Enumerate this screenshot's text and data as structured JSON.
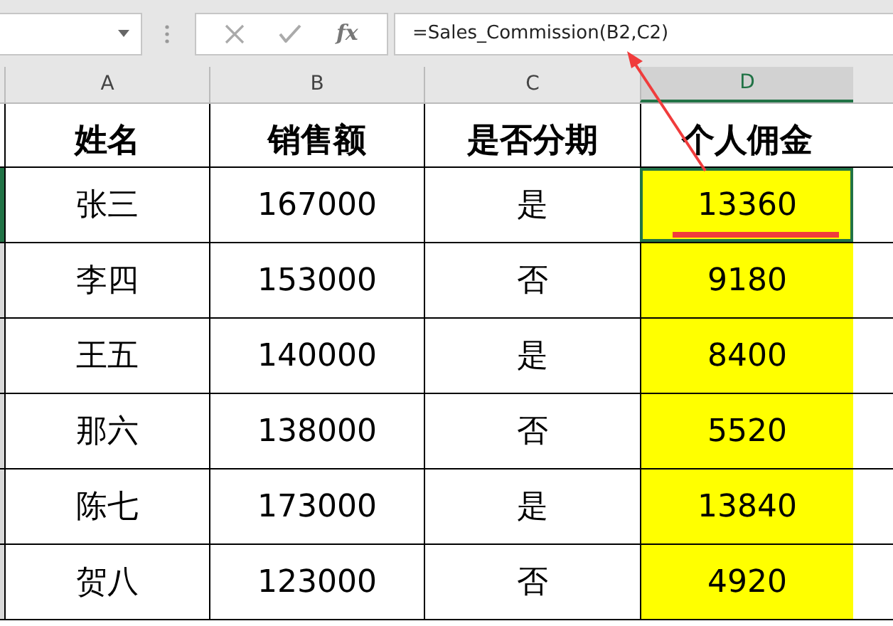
{
  "formula_bar": {
    "formula": "=Sales_Commission(B2,C2)",
    "fx": "fx"
  },
  "columns": [
    {
      "label": "A",
      "selected": false
    },
    {
      "label": "B",
      "selected": false
    },
    {
      "label": "C",
      "selected": false
    },
    {
      "label": "D",
      "selected": true
    }
  ],
  "header": [
    "姓名",
    "销售额",
    "是否分期",
    "个人佣金"
  ],
  "rows": [
    {
      "cells": [
        "张三",
        "167000",
        "是",
        "13360"
      ],
      "selected": true
    },
    {
      "cells": [
        "李四",
        "153000",
        "否",
        "9180"
      ],
      "selected": false
    },
    {
      "cells": [
        "王五",
        "140000",
        "是",
        "8400"
      ],
      "selected": false
    },
    {
      "cells": [
        "那六",
        "138000",
        "否",
        "5520"
      ],
      "selected": false
    },
    {
      "cells": [
        "陈七",
        "173000",
        "是",
        "13840"
      ],
      "selected": false
    },
    {
      "cells": [
        "贺八",
        "123000",
        "否",
        "4920"
      ],
      "selected": false
    }
  ]
}
